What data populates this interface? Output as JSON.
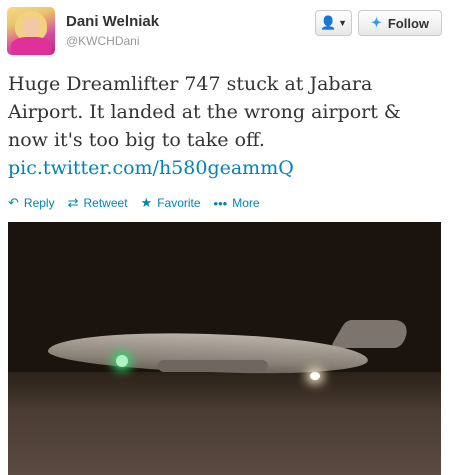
{
  "user": {
    "display_name": "Dani Welniak",
    "handle": "@KWCHDani"
  },
  "buttons": {
    "user_menu_icon": "person-dropdown-icon",
    "follow_label": "Follow"
  },
  "tweet": {
    "text": "Huge Dreamlifter 747 stuck at Jabara Airport. It landed at the wrong airport & now it's too big to take off.",
    "link": "pic.twitter.com/h580geammQ"
  },
  "actions": [
    {
      "label": "Reply",
      "icon": "reply-icon"
    },
    {
      "label": "Retweet",
      "icon": "retweet-icon"
    },
    {
      "label": "Favorite",
      "icon": "star-icon"
    },
    {
      "label": "More",
      "icon": "more-dots-icon"
    }
  ],
  "colors": {
    "link": "#0084b4",
    "text": "#333333",
    "muted": "#999999",
    "bird": "#2ea1e6"
  }
}
